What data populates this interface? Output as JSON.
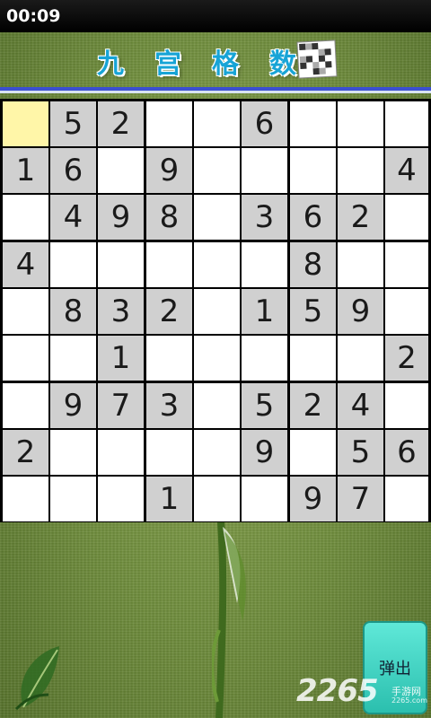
{
  "status_bar": {
    "time": "00:09"
  },
  "title": {
    "chars": [
      "九",
      "宫",
      "格",
      "数"
    ],
    "logo_icon": "sudoku-grid-icon"
  },
  "board": {
    "rows": [
      [
        "",
        "5",
        "2",
        "",
        "",
        "6",
        "",
        "",
        ""
      ],
      [
        "1",
        "6",
        "",
        "9",
        "",
        "",
        "",
        "",
        "4"
      ],
      [
        "",
        "4",
        "9",
        "8",
        "",
        "3",
        "6",
        "2",
        ""
      ],
      [
        "4",
        "",
        "",
        "",
        "",
        "",
        "8",
        "",
        ""
      ],
      [
        "",
        "8",
        "3",
        "2",
        "",
        "1",
        "5",
        "9",
        ""
      ],
      [
        "",
        "",
        "1",
        "",
        "",
        "",
        "",
        "",
        "2"
      ],
      [
        "",
        "9",
        "7",
        "3",
        "",
        "5",
        "2",
        "4",
        ""
      ],
      [
        "2",
        "",
        "",
        "",
        "",
        "9",
        "",
        "5",
        "6"
      ],
      [
        "",
        "",
        "",
        "1",
        "",
        "",
        "9",
        "7",
        ""
      ]
    ],
    "given_color": "#d0d0d0",
    "empty_color": "#ffffff",
    "selected_cell": [
      0,
      0
    ],
    "selected_color": "#fff6a8"
  },
  "popup_button": {
    "label": "弹出"
  },
  "watermark": {
    "number": "2265",
    "text": "手游网",
    "url": "2265.com"
  },
  "colors": {
    "title_blue": "#17a4d6",
    "separator_blue": "#3b4fd1",
    "button_teal": "#3ed0bf"
  }
}
